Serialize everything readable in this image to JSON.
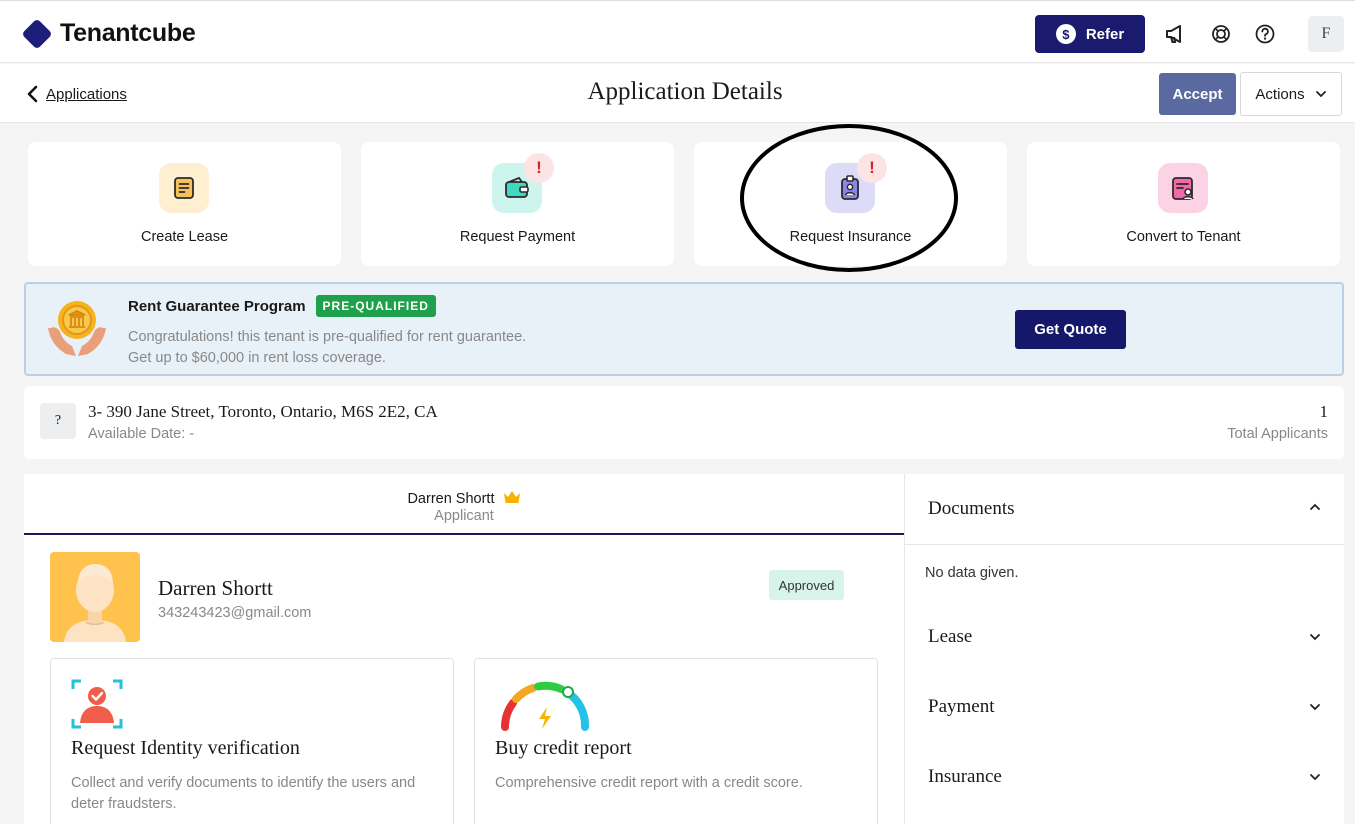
{
  "brand": {
    "name": "Tenantcube",
    "color": "#1d1d7a"
  },
  "topbar": {
    "refer_label": "Refer",
    "refer_icon": "dollar-circle-icon",
    "icons": [
      "megaphone-icon",
      "support-icon",
      "help-icon"
    ],
    "user_initial": "F"
  },
  "subheader": {
    "back_label": "Applications",
    "title": "Application Details",
    "accept_label": "Accept",
    "actions_label": "Actions"
  },
  "quick_actions": [
    {
      "label": "Create Lease",
      "icon": "document-icon",
      "color": "#fdefd0",
      "alert": false
    },
    {
      "label": "Request Payment",
      "icon": "wallet-icon",
      "color": "#cdf5ee",
      "alert": true,
      "alert_mark": "!"
    },
    {
      "label": "Request Insurance",
      "icon": "id-badge-icon",
      "color": "#dcdcf8",
      "alert": true,
      "alert_mark": "!"
    },
    {
      "label": "Convert to Tenant",
      "icon": "contract-icon",
      "color": "#fbd3e4",
      "alert": false
    }
  ],
  "banner": {
    "title": "Rent Guarantee Program",
    "badge": "PRE-QUALIFIED",
    "line1": "Congratulations! this tenant is pre-qualified for rent guarantee.",
    "line2": "Get up to $60,000 in rent loss coverage.",
    "button": "Get Quote"
  },
  "property": {
    "placeholder_icon": "?",
    "address": "3- 390 Jane Street, Toronto, Ontario, M6S 2E2, CA",
    "available": "Available Date: -",
    "applicant_count": "1",
    "applicant_count_label": "Total Applicants"
  },
  "applicant": {
    "tab_name": "Darren Shortt",
    "tab_role": "Applicant",
    "name": "Darren Shortt",
    "email": "343243423@gmail.com",
    "status": "Approved"
  },
  "services": [
    {
      "title": "Request Identity verification",
      "desc": "Collect and verify documents to identify the users and deter fraudsters.",
      "icon": "identity-scan-icon"
    },
    {
      "title": "Buy credit report",
      "desc": "Comprehensive credit report with a credit score.",
      "icon": "credit-gauge-icon"
    }
  ],
  "side_panel": {
    "sections": [
      {
        "title": "Documents",
        "expanded": true,
        "body": "No data given."
      },
      {
        "title": "Lease",
        "expanded": false
      },
      {
        "title": "Payment",
        "expanded": false
      },
      {
        "title": "Insurance",
        "expanded": false
      }
    ]
  }
}
